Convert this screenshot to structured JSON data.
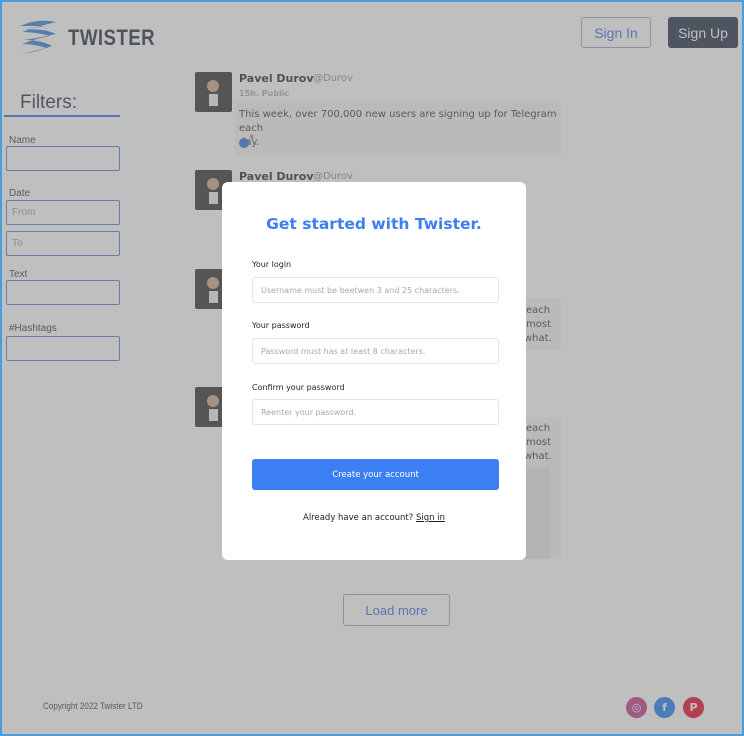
{
  "header": {
    "logo_text": "TWISTER",
    "signin_label": "Sign In",
    "signup_label": "Sign Up"
  },
  "filters": {
    "title": "Filters:",
    "name_label": "Name",
    "date_label": "Date",
    "date_from_placeholder": "From",
    "date_to_placeholder": "To",
    "text_label": "Text",
    "hashtags_label": "#Hashtags"
  },
  "posts": [
    {
      "author": "Pavel Durov",
      "handle": "@Durov",
      "meta": "15h. Public",
      "text_line1": "This week, over 700,000 new users are signing up for Telegram each",
      "text_line2": "day.",
      "reaction_count": "8"
    },
    {
      "author": "Pavel Durov",
      "handle": "@Durov"
    },
    {
      "fragments": [
        "each",
        "most",
        "what."
      ]
    },
    {
      "fragments": [
        "each",
        "most",
        "what."
      ]
    }
  ],
  "load_more_label": "Load more",
  "footer": {
    "copyright": "Copyright 2022 Twister LTD",
    "social": [
      {
        "icon": "instagram-icon",
        "glyph": "◎",
        "color": "#c13584"
      },
      {
        "icon": "facebook-icon",
        "glyph": "f",
        "color": "#1877f2"
      },
      {
        "icon": "pinterest-icon",
        "glyph": "P",
        "color": "#e60023"
      }
    ]
  },
  "modal": {
    "title": "Get started with Twister.",
    "login_label": "Your login",
    "login_placeholder": "Username  must be beetwen 3 and 25 characters.",
    "password_label": "Your password",
    "password_placeholder": "Password must has at least 8 characters.",
    "confirm_label": "Confirm your password",
    "confirm_placeholder": "Reenter your password.",
    "create_button": "Create your account",
    "footer_text": "Already have an account?",
    "signin_link": "Sign in"
  },
  "colors": {
    "accent": "#3b7ff2",
    "dark": "#1f2b40",
    "frame": "#4a9fd8"
  }
}
